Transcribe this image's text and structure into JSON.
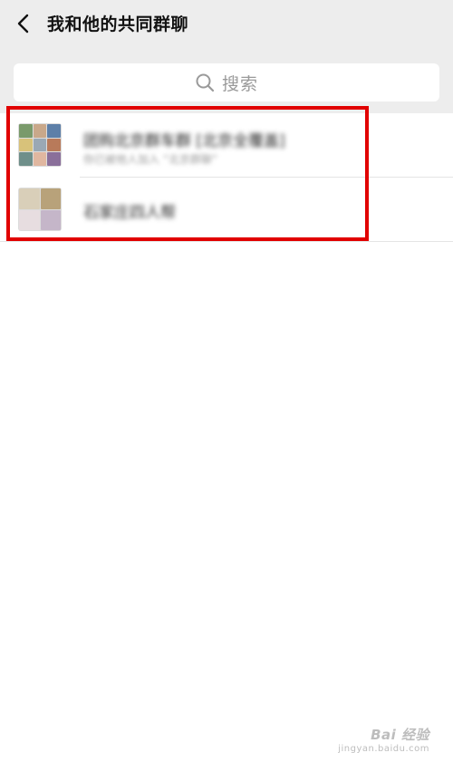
{
  "header": {
    "title": "我和他的共同群聊",
    "back_icon": "chevron-left-icon"
  },
  "search": {
    "placeholder": "搜索",
    "icon": "search-icon"
  },
  "groups": [
    {
      "name": "团购北京群车群 [北京全覆盖]",
      "subtitle": "你已被他人加入 “北京群聊”",
      "avatar_tiles": 9
    },
    {
      "name": "石家庄四人帮",
      "avatar_tiles": 4
    }
  ],
  "highlight": {
    "color": "#e10000"
  },
  "watermark": {
    "brand": "Bai 经验",
    "url": "jingyan.baidu.com"
  }
}
